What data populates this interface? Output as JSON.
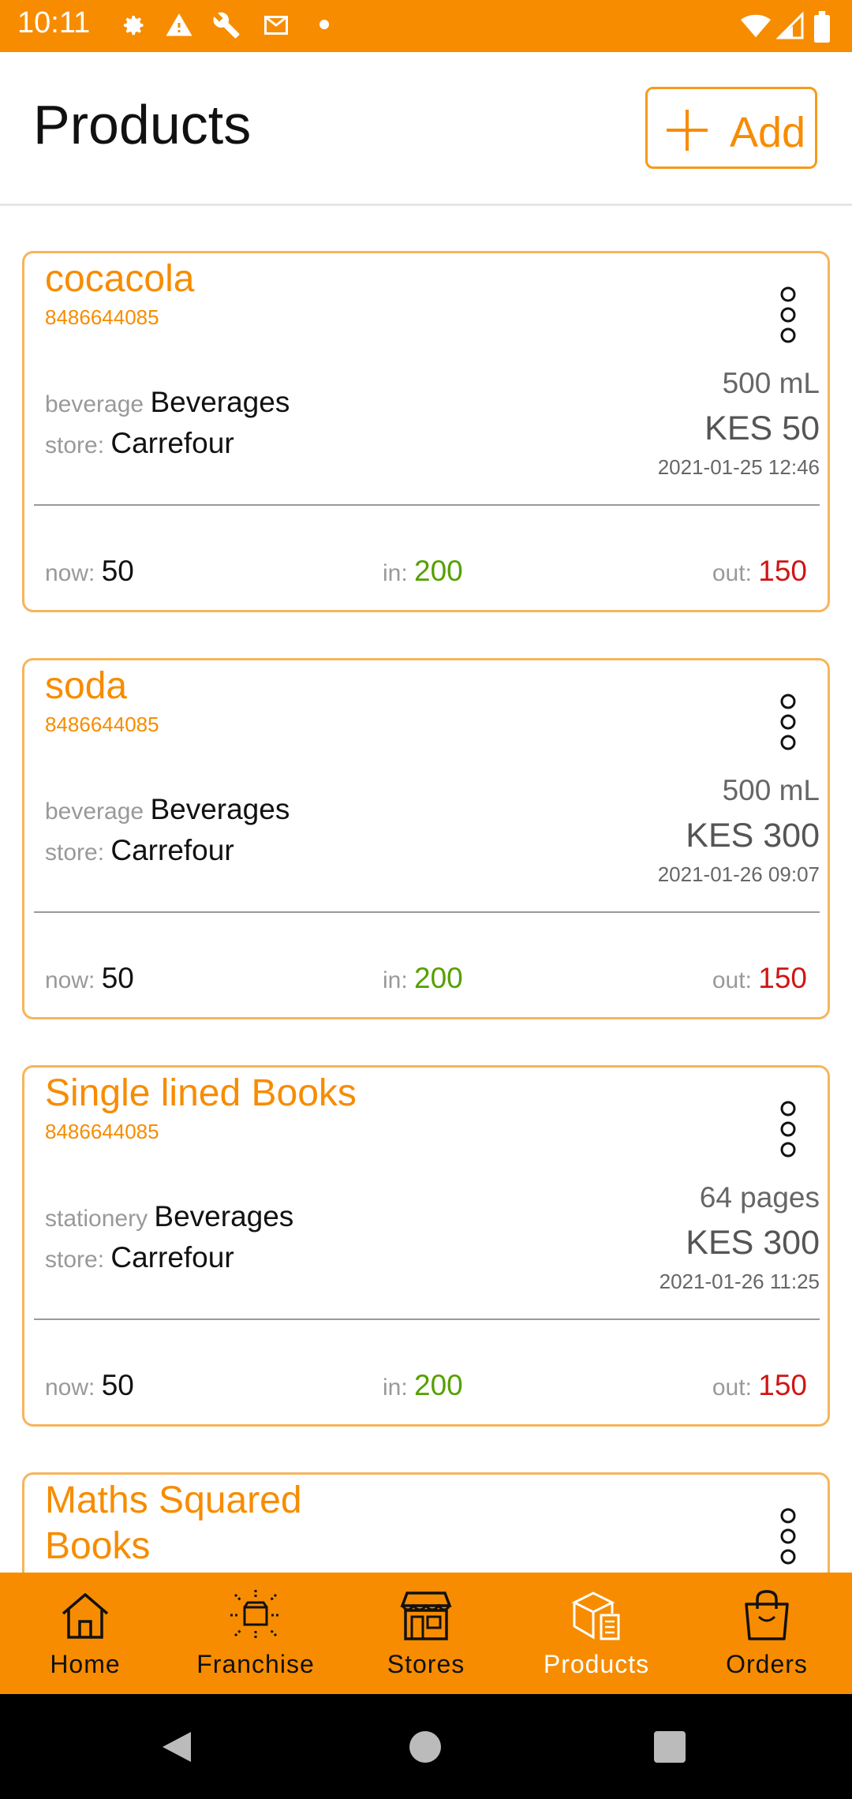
{
  "status_bar": {
    "time": "10:11",
    "icons_left": [
      "gear-icon",
      "warning-icon",
      "wrench-icon",
      "gmail-icon",
      "dot-icon"
    ],
    "icons_right": [
      "wifi-icon",
      "signal-icon",
      "battery-icon"
    ]
  },
  "header": {
    "title": "Products",
    "add_label": "Add"
  },
  "products": [
    {
      "name": "cocacola",
      "code": "8486644085",
      "category_label": "beverage",
      "category_value": "Beverages",
      "store_label": "store:",
      "store_value": "Carrefour",
      "size": "500 mL",
      "price": "KES 50",
      "date": "2021-01-25 12:46",
      "now_label": "now:",
      "now_value": "50",
      "in_label": "in:",
      "in_value": "200",
      "out_label": "out:",
      "out_value": "150"
    },
    {
      "name": "soda",
      "code": "8486644085",
      "category_label": "beverage",
      "category_value": "Beverages",
      "store_label": "store:",
      "store_value": "Carrefour",
      "size": "500 mL",
      "price": "KES 300",
      "date": "2021-01-26 09:07",
      "now_label": "now:",
      "now_value": "50",
      "in_label": "in:",
      "in_value": "200",
      "out_label": "out:",
      "out_value": "150"
    },
    {
      "name": "Single lined Books",
      "code": "8486644085",
      "category_label": "stationery",
      "category_value": "Beverages",
      "store_label": "store:",
      "store_value": "Carrefour",
      "size": "64 pages",
      "price": "KES 300",
      "date": "2021-01-26 11:25",
      "now_label": "now:",
      "now_value": "50",
      "in_label": "in:",
      "in_value": "200",
      "out_label": "out:",
      "out_value": "150"
    },
    {
      "name_line1": "Maths Squared",
      "name_line2": "Books"
    }
  ],
  "bottom_nav": {
    "items": [
      {
        "label": "Home",
        "icon": "home-icon"
      },
      {
        "label": "Franchise",
        "icon": "franchise-icon"
      },
      {
        "label": "Stores",
        "icon": "store-icon"
      },
      {
        "label": "Products",
        "icon": "products-icon",
        "active": true
      },
      {
        "label": "Orders",
        "icon": "orders-icon"
      }
    ]
  },
  "system_nav": [
    "back-icon",
    "home-circle-icon",
    "recents-icon"
  ],
  "colors": {
    "accent": "#f78c00",
    "in_value": "#55a000",
    "out_value": "#d01515",
    "card_border": "#f7b45c"
  }
}
